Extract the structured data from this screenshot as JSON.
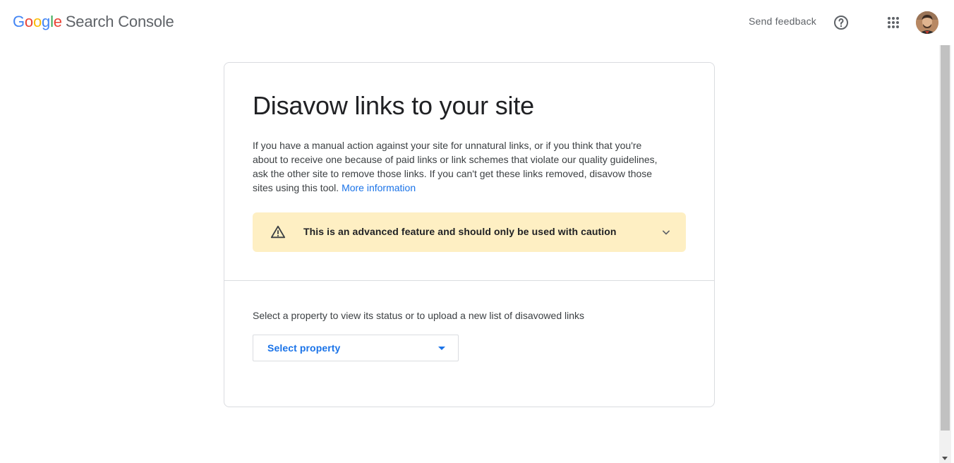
{
  "header": {
    "logo": {
      "letters": [
        "G",
        "o",
        "o",
        "g",
        "l",
        "e"
      ],
      "product": "Search Console"
    },
    "send_feedback": "Send feedback",
    "help_icon": "help-circle-icon",
    "apps_icon": "apps-grid-icon",
    "avatar_icon": "account-avatar"
  },
  "card": {
    "title": "Disavow links to your site",
    "description": "If you have a manual action against your site for unnatural links, or if you think that you're about to receive one because of paid links or link schemes that violate our quality guidelines, ask the other site to remove those links. If you can't get these links removed, disavow those sites using this tool.",
    "more_info_link": "More information",
    "warning": {
      "icon": "warning-triangle-icon",
      "text": "This is an advanced feature and should only be used with caution",
      "expand_icon": "chevron-down-icon"
    },
    "select_label": "Select a property to view its status or to upload a new list of disavowed links",
    "select_property": {
      "value": "Select property",
      "icon": "dropdown-caret-icon"
    }
  },
  "colors": {
    "google_blue": "#4285f4",
    "google_red": "#ea4335",
    "google_yellow": "#fbbc05",
    "google_green": "#34a853",
    "link_blue": "#1a73e8",
    "warning_bg": "#feefc3"
  }
}
